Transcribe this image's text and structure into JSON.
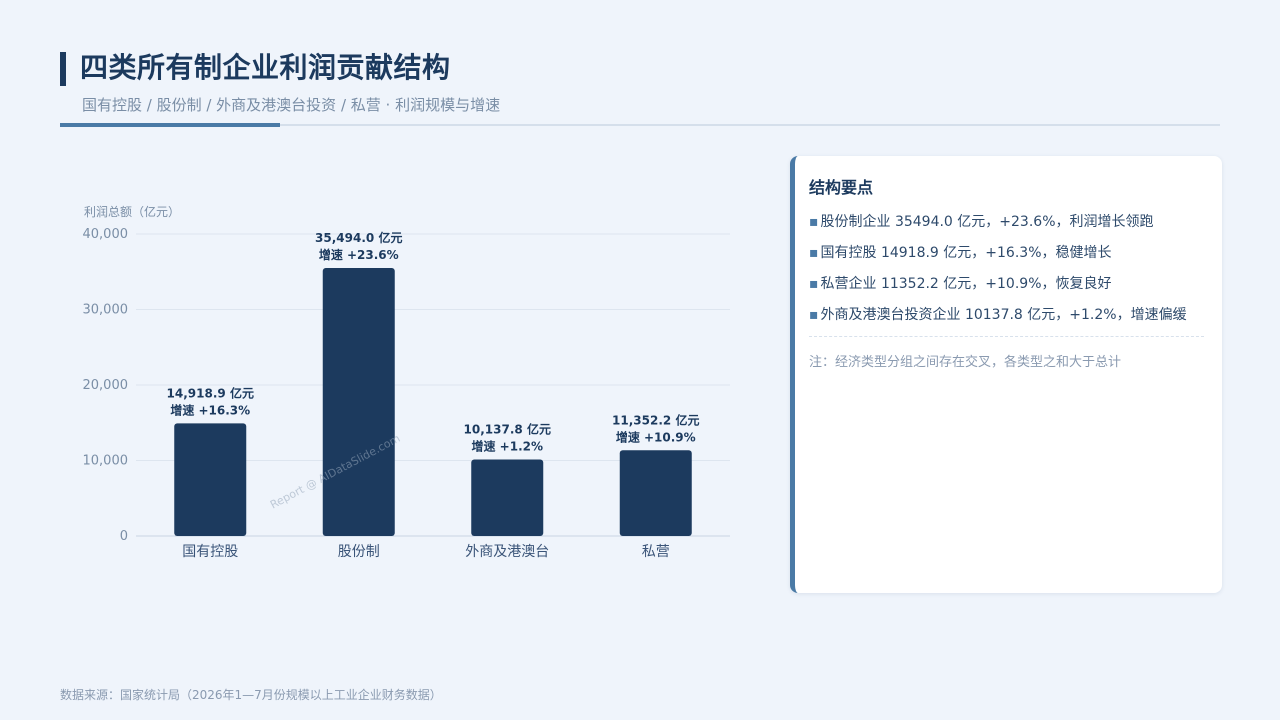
{
  "header": {
    "title": "四类所有制企业利润贡献结构",
    "subtitle": "国有控股 / 股份制 / 外商及港澳台投资 / 私营 · 利润规模与增速"
  },
  "chart_data": {
    "type": "bar",
    "ylabel": "利润总额（亿元）",
    "xlabel": "",
    "ylim": [
      0,
      40000
    ],
    "yticks": [
      "0",
      "10,000",
      "20,000",
      "30,000",
      "40,000"
    ],
    "ytick_values": [
      0,
      10000,
      20000,
      30000,
      40000
    ],
    "grid": true,
    "categories": [
      "国有控股",
      "股份制",
      "外商及港澳台",
      "私营"
    ],
    "values": [
      14918.9,
      35494.0,
      10137.8,
      11352.2
    ],
    "value_labels": [
      "14,918.9 亿元",
      "35,494.0 亿元",
      "10,137.8 亿元",
      "11,352.2 亿元"
    ],
    "growth_labels": [
      "增速 +16.3%",
      "增速 +23.6%",
      "增速 +1.2%",
      "增速 +10.9%"
    ],
    "bar_color": "#1c3a5e"
  },
  "panel": {
    "title": "结构要点",
    "bullet": "▪",
    "items": [
      "股份制企业 35494.0 亿元，+23.6%，利润增长领跑",
      "国有控股 14918.9 亿元，+16.3%，稳健增长",
      "私营企业 11352.2 亿元，+10.9%，恢复良好",
      "外商及港澳台投资企业 10137.8 亿元，+1.2%，增速偏缓"
    ],
    "note": "注：经济类型分组之间存在交叉，各类型之和大于总计"
  },
  "footer": {
    "source": "数据来源：国家统计局（2026年1—7月份规模以上工业企业财务数据）"
  },
  "watermark": "Report @ AIDataSlide.com",
  "colors": {
    "accent": "#4a7aa6",
    "primary": "#1c3a5e",
    "background": "#eff4fb"
  }
}
